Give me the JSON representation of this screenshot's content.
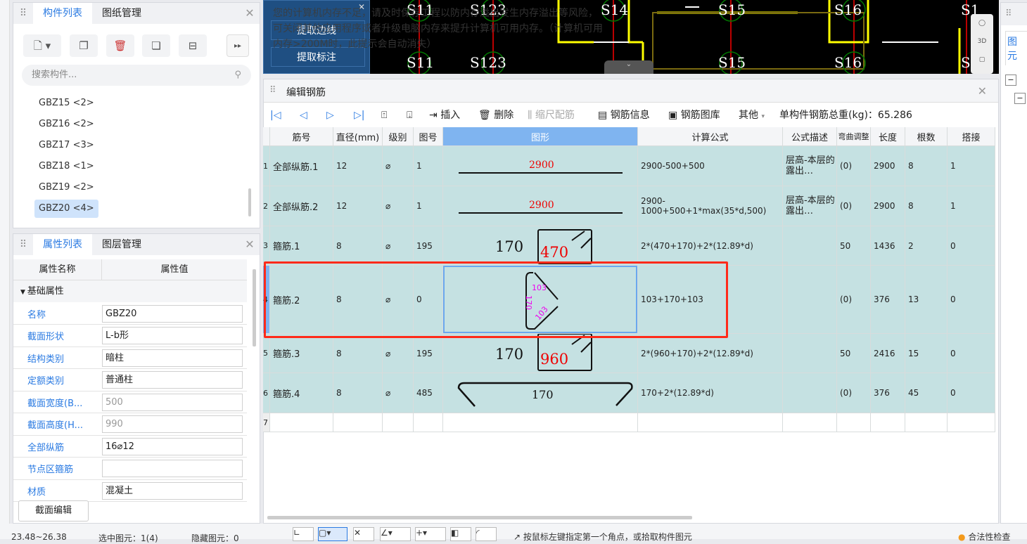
{
  "left_panel": {
    "tabs": [
      "构件列表",
      "图纸管理"
    ],
    "search_placeholder": "搜索构件...",
    "items": [
      "GBZ15 <2>",
      "GBZ16 <2>",
      "GBZ17 <3>",
      "GBZ18 <1>",
      "GBZ19 <2>",
      "GBZ20 <4>"
    ],
    "selected_index": 5
  },
  "property_panel": {
    "tabs": [
      "属性列表",
      "图层管理"
    ],
    "headers": [
      "属性名称",
      "属性值"
    ],
    "group": "基础属性",
    "rows": [
      {
        "name": "名称",
        "value": "GBZ20"
      },
      {
        "name": "截面形状",
        "value": "L-b形"
      },
      {
        "name": "结构类别",
        "value": "暗柱"
      },
      {
        "name": "定额类别",
        "value": "普通柱"
      },
      {
        "name": "截面宽度(B...",
        "value": "500"
      },
      {
        "name": "截面高度(H...",
        "value": "990"
      },
      {
        "name": "全部纵筋",
        "value": "16⌀12"
      },
      {
        "name": "节点区箍筋",
        "value": ""
      },
      {
        "name": "材质",
        "value": "混凝土"
      }
    ],
    "section_edit_button": "截面编辑"
  },
  "cad": {
    "menu": [
      "提取边线",
      "提取标注"
    ],
    "warning": "您的计算机内存不足，请及时保存工程以防内存溢出发生内存溢出等风险，可关闭其他应用程序或者升级电脑内存来提升计算机可用内存。（计算机可用内存>200M时，此提示会自动消失）",
    "axis_labels_top": [
      "S11",
      "S123",
      "S14",
      "S15",
      "S16",
      "S1"
    ],
    "axis_labels_bottom": [
      "S11",
      "S123",
      "S15",
      "S16",
      "S1"
    ]
  },
  "rebar_editor": {
    "title": "编辑钢筋",
    "toolbar": {
      "insert": "插入",
      "delete": "删除",
      "scale": "缩尺配筋",
      "info": "钢筋信息",
      "library": "钢筋图库",
      "other": "其他",
      "total_weight": "单构件钢筋总重(kg)：65.286"
    },
    "headers": [
      "筋号",
      "直径(mm)",
      "级别",
      "图号",
      "图形",
      "计算公式",
      "公式描述",
      "弯曲调整",
      "长度",
      "根数",
      "搭接"
    ],
    "rows": [
      {
        "idx": "1",
        "name": "全部纵筋.1",
        "dia": "12",
        "grade": "⌀",
        "fig": "1",
        "shape": [
          "2900"
        ],
        "formula": "2900-500+500",
        "desc": "层高-本层的露出…",
        "bend": "(0)",
        "len": "2900",
        "count": "8",
        "lap": "1"
      },
      {
        "idx": "2",
        "name": "全部纵筋.2",
        "dia": "12",
        "grade": "⌀",
        "fig": "1",
        "shape": [
          "2900"
        ],
        "formula": "2900-1000+500+1*max(35*d,500)",
        "desc": "层高-本层的露出…",
        "bend": "(0)",
        "len": "2900",
        "count": "8",
        "lap": "1"
      },
      {
        "idx": "3",
        "name": "箍筋.1",
        "dia": "8",
        "grade": "⌀",
        "fig": "195",
        "shape": [
          "170",
          "470"
        ],
        "formula": "2*(470+170)+2*(12.89*d)",
        "desc": "",
        "bend": "50",
        "len": "1436",
        "count": "2",
        "lap": "0"
      },
      {
        "idx": "4",
        "name": "箍筋.2",
        "dia": "8",
        "grade": "⌀",
        "fig": "0",
        "shape": [
          "103",
          "170",
          "103"
        ],
        "formula": "103+170+103",
        "desc": "",
        "bend": "(0)",
        "len": "376",
        "count": "13",
        "lap": "0"
      },
      {
        "idx": "5",
        "name": "箍筋.3",
        "dia": "8",
        "grade": "⌀",
        "fig": "195",
        "shape": [
          "170",
          "960"
        ],
        "formula": "2*(960+170)+2*(12.89*d)",
        "desc": "",
        "bend": "50",
        "len": "2416",
        "count": "15",
        "lap": "0"
      },
      {
        "idx": "6",
        "name": "箍筋.4",
        "dia": "8",
        "grade": "⌀",
        "fig": "485",
        "shape": [
          "170"
        ],
        "formula": "170+2*(12.89*d)",
        "desc": "",
        "bend": "(0)",
        "len": "376",
        "count": "45",
        "lap": "0"
      },
      {
        "idx": "7",
        "name": "",
        "dia": "",
        "grade": "",
        "fig": "",
        "shape": [],
        "formula": "",
        "desc": "",
        "bend": "",
        "len": "",
        "count": "",
        "lap": ""
      }
    ],
    "selected_row": 3,
    "highlight_color": "#ff2a1a"
  },
  "right_panel": {
    "tab": "图元"
  },
  "status_bar": {
    "coords": "23.48~26.38",
    "selected": "选中图元：1(4)",
    "hidden": "隐藏图元：0",
    "hint": "按鼠标左键指定第一个角点，或拾取构件图元",
    "check": "合法性检查"
  }
}
